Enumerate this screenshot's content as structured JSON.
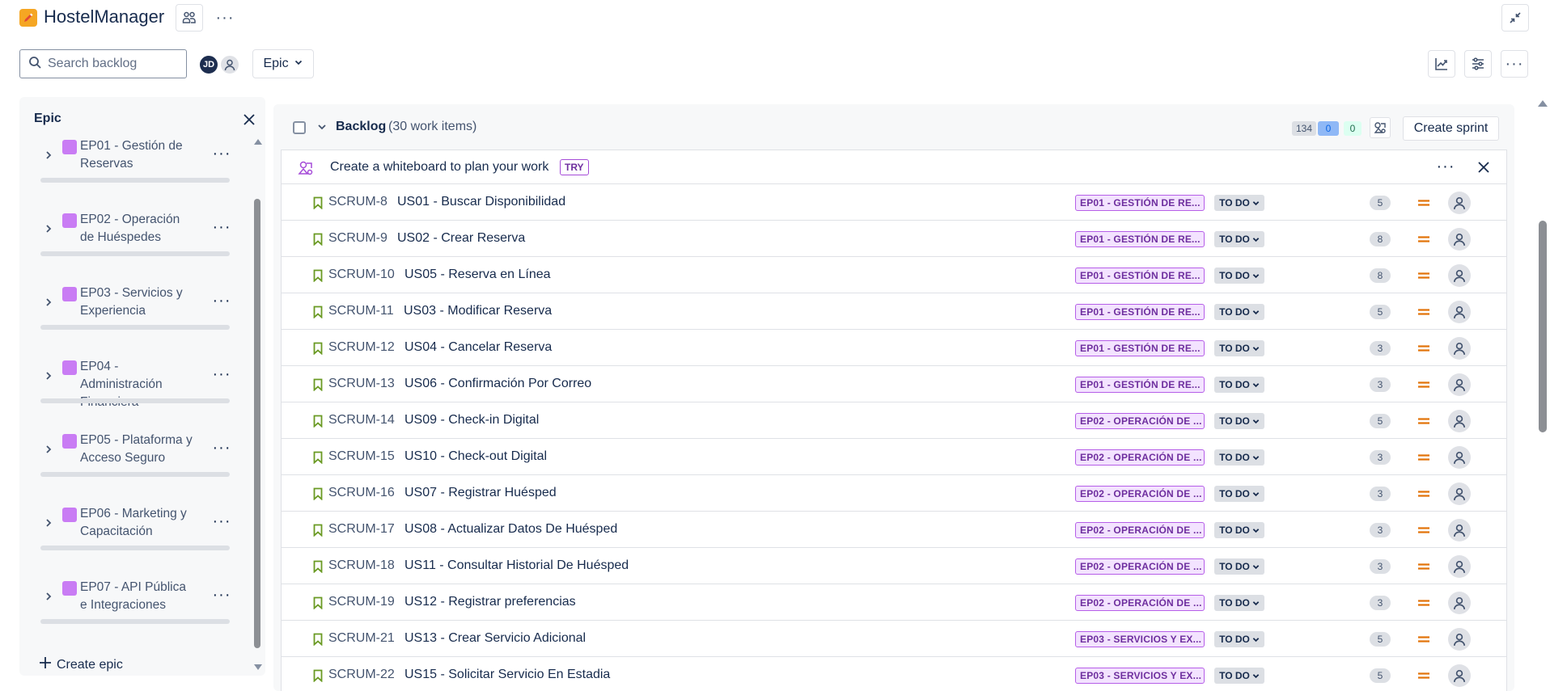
{
  "header": {
    "app_title": "HostelManager",
    "logo_icon": "pencil-logo-icon",
    "more_label": "···"
  },
  "toolbar": {
    "search_placeholder": "Search backlog",
    "avatar_initials": "JD",
    "epic_filter_label": "Epic"
  },
  "epic_panel": {
    "title": "Epic",
    "create_label": "Create epic",
    "items": [
      {
        "name": "EP01 - Gestión de Reservas"
      },
      {
        "name": "EP02 - Operación de Huéspedes"
      },
      {
        "name": "EP03 - Servicios y Experiencia"
      },
      {
        "name": "EP04 - Administración Financiera"
      },
      {
        "name": "EP05 - Plataforma y Acceso Seguro"
      },
      {
        "name": "EP06 - Marketing y Capacitación"
      },
      {
        "name": "EP07 - API Pública e Integraciones"
      }
    ]
  },
  "backlog": {
    "title": "Backlog",
    "count_label": "(30 work items)",
    "points_todo": "134",
    "points_in_progress": "0",
    "points_done": "0",
    "create_sprint_label": "Create sprint",
    "whiteboard_banner": {
      "text": "Create a whiteboard to plan your work",
      "badge": "TRY"
    },
    "issues": [
      {
        "key": "SCRUM-8",
        "summary": "US01 - Buscar Disponibilidad",
        "epic": "EP01 - GESTIÓN DE RE...",
        "status": "TO DO",
        "points": "5"
      },
      {
        "key": "SCRUM-9",
        "summary": "US02 - Crear Reserva",
        "epic": "EP01 - GESTIÓN DE RE...",
        "status": "TO DO",
        "points": "8"
      },
      {
        "key": "SCRUM-10",
        "summary": "US05 - Reserva en Línea",
        "epic": "EP01 - GESTIÓN DE RE...",
        "status": "TO DO",
        "points": "8"
      },
      {
        "key": "SCRUM-11",
        "summary": "US03 - Modificar Reserva",
        "epic": "EP01 - GESTIÓN DE RE...",
        "status": "TO DO",
        "points": "5"
      },
      {
        "key": "SCRUM-12",
        "summary": "US04 - Cancelar Reserva",
        "epic": "EP01 - GESTIÓN DE RE...",
        "status": "TO DO",
        "points": "3"
      },
      {
        "key": "SCRUM-13",
        "summary": "US06 - Confirmación Por Correo",
        "epic": "EP01 - GESTIÓN DE RE...",
        "status": "TO DO",
        "points": "3"
      },
      {
        "key": "SCRUM-14",
        "summary": "US09 - Check-in Digital",
        "epic": "EP02 - OPERACIÓN DE ...",
        "status": "TO DO",
        "points": "5"
      },
      {
        "key": "SCRUM-15",
        "summary": "US10 - Check-out Digital",
        "epic": "EP02 - OPERACIÓN DE ...",
        "status": "TO DO",
        "points": "3"
      },
      {
        "key": "SCRUM-16",
        "summary": "US07 - Registrar Huésped",
        "epic": "EP02 - OPERACIÓN DE ...",
        "status": "TO DO",
        "points": "3"
      },
      {
        "key": "SCRUM-17",
        "summary": "US08 - Actualizar Datos De Huésped",
        "epic": "EP02 - OPERACIÓN DE ...",
        "status": "TO DO",
        "points": "3"
      },
      {
        "key": "SCRUM-18",
        "summary": "US11 - Consultar Historial De Huésped",
        "epic": "EP02 - OPERACIÓN DE ...",
        "status": "TO DO",
        "points": "3"
      },
      {
        "key": "SCRUM-19",
        "summary": "US12 - Registrar preferencias",
        "epic": "EP02 - OPERACIÓN DE ...",
        "status": "TO DO",
        "points": "3"
      },
      {
        "key": "SCRUM-21",
        "summary": "US13 - Crear Servicio Adicional",
        "epic": "EP03 - SERVICIOS Y EX...",
        "status": "TO DO",
        "points": "5"
      },
      {
        "key": "SCRUM-22",
        "summary": "US15 - Solicitar Servicio En Estadia",
        "epic": "EP03 - SERVICIOS Y EX...",
        "status": "TO DO",
        "points": "5"
      }
    ]
  },
  "colors": {
    "epic_swatch": "#c97cf4",
    "epic_lozenge_bg": "#f3e3ff",
    "epic_lozenge_text": "#6e2e9e",
    "story_icon": "#6a9a23",
    "priority_medium": "#e2740b",
    "avatar_jd": "#1d2d4f"
  }
}
